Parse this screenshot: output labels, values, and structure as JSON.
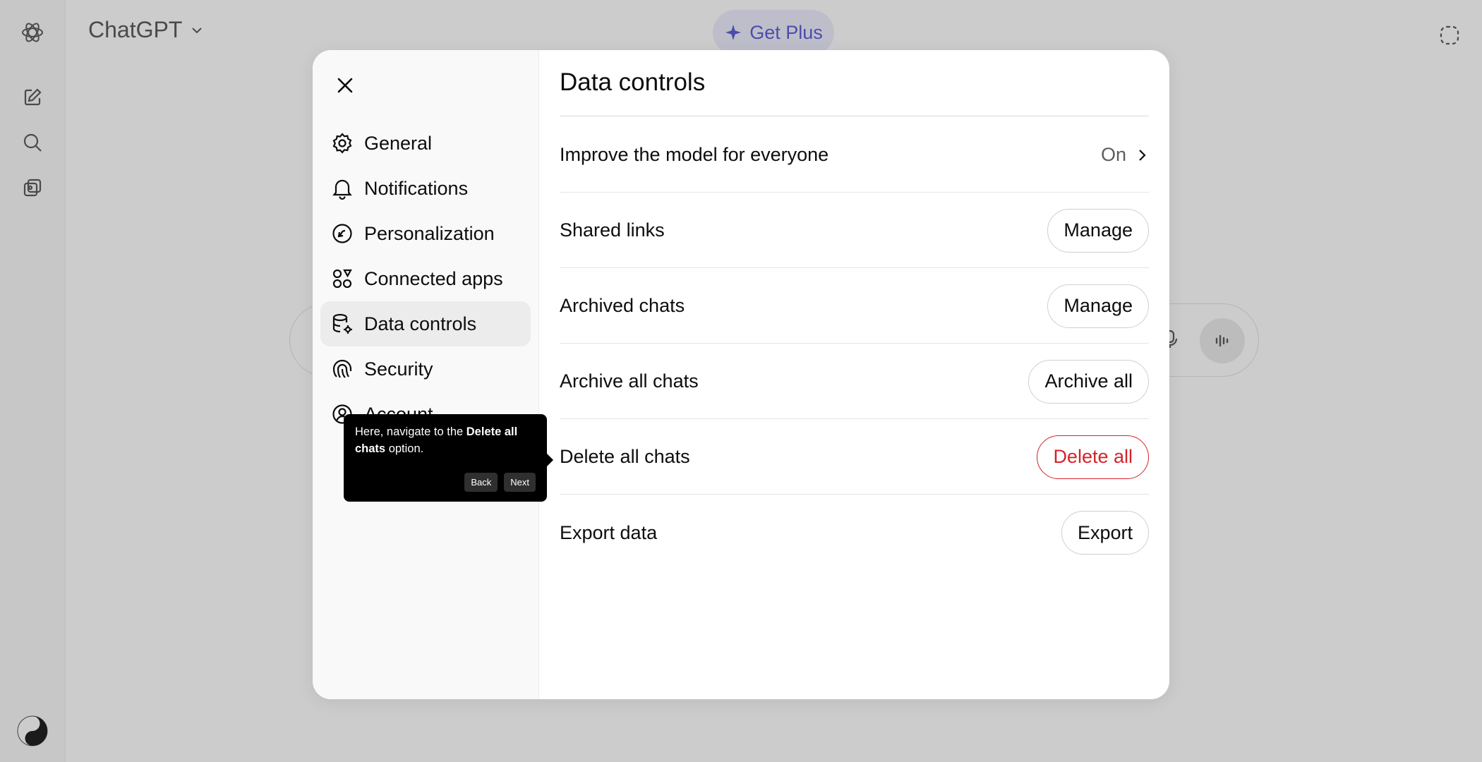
{
  "app": {
    "title": "ChatGPT",
    "get_plus": "Get Plus"
  },
  "settings": {
    "nav": [
      {
        "label": "General",
        "icon": "gear-icon"
      },
      {
        "label": "Notifications",
        "icon": "bell-icon"
      },
      {
        "label": "Personalization",
        "icon": "personalization-icon"
      },
      {
        "label": "Connected apps",
        "icon": "apps-icon"
      },
      {
        "label": "Data controls",
        "icon": "database-gear-icon",
        "active": true
      },
      {
        "label": "Security",
        "icon": "fingerprint-icon"
      },
      {
        "label": "Account",
        "icon": "account-icon"
      }
    ],
    "section_title": "Data controls",
    "rows": [
      {
        "label": "Improve the model for everyone",
        "value": "On"
      },
      {
        "label": "Shared links",
        "button": "Manage"
      },
      {
        "label": "Archived chats",
        "button": "Manage"
      },
      {
        "label": "Archive all chats",
        "button": "Archive all"
      },
      {
        "label": "Delete all chats",
        "button": "Delete all"
      },
      {
        "label": "Export data",
        "button": "Export"
      }
    ]
  },
  "tooltip": {
    "text_pre": "Here, navigate to the ",
    "text_bold": "Delete all chats",
    "text_post": " option.",
    "back": "Back",
    "next": "Next"
  },
  "colors": {
    "danger": "#d4232a",
    "get_plus_bg": "#eeeefe",
    "get_plus_text": "#5f5fd8",
    "active_nav_bg": "#ececec"
  }
}
